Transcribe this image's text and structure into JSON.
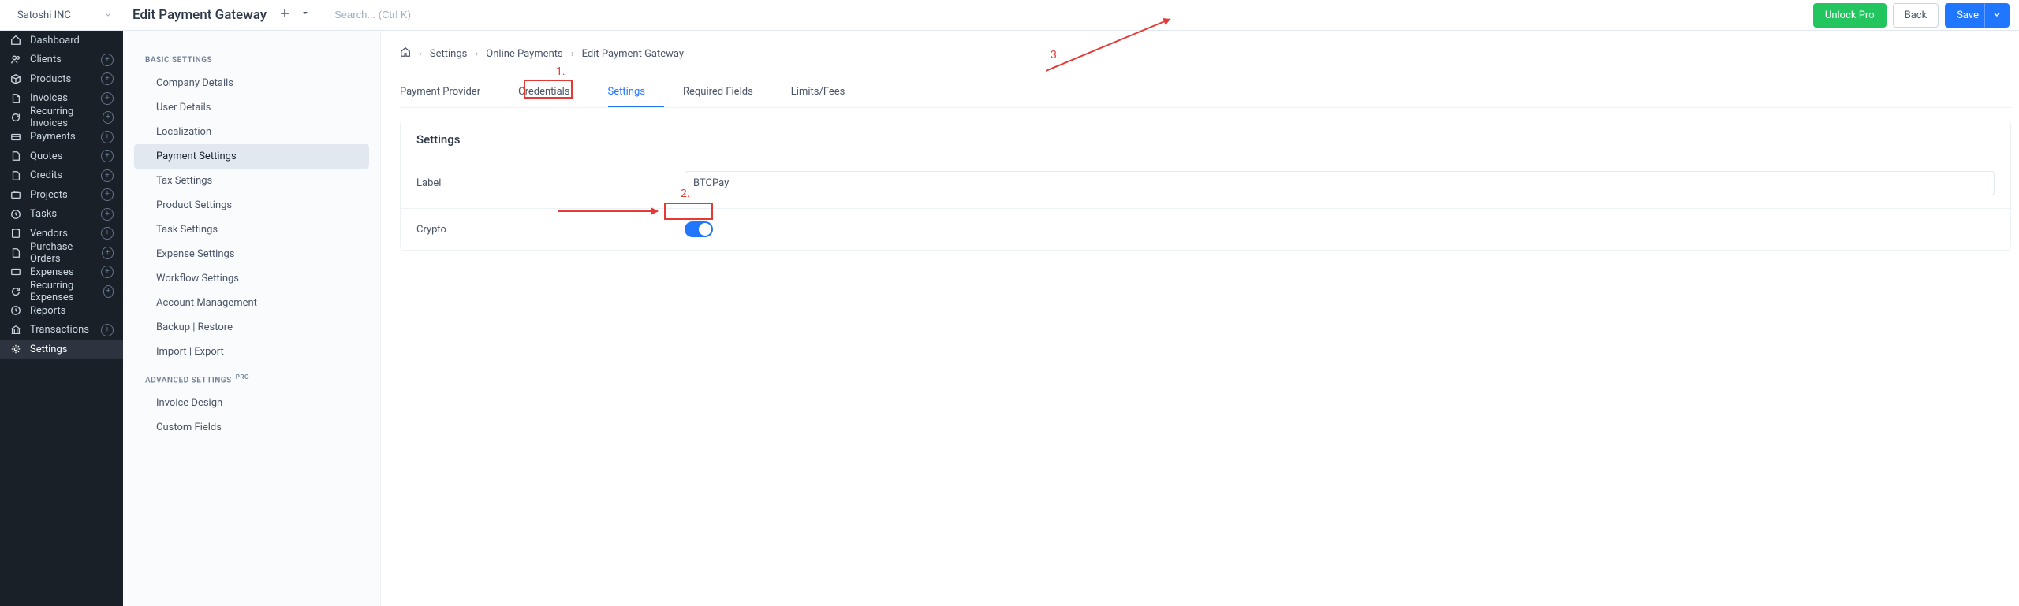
{
  "topbar": {
    "company_name": "Satoshi INC",
    "page_title": "Edit Payment Gateway",
    "search_placeholder": "Search... (Ctrl K)",
    "unlock_pro": "Unlock Pro",
    "back": "Back",
    "save": "Save"
  },
  "sidebar": {
    "items": [
      {
        "label": "Dashboard",
        "plus": false
      },
      {
        "label": "Clients",
        "plus": true
      },
      {
        "label": "Products",
        "plus": true
      },
      {
        "label": "Invoices",
        "plus": true
      },
      {
        "label": "Recurring Invoices",
        "plus": true
      },
      {
        "label": "Payments",
        "plus": true
      },
      {
        "label": "Quotes",
        "plus": true
      },
      {
        "label": "Credits",
        "plus": true
      },
      {
        "label": "Projects",
        "plus": true
      },
      {
        "label": "Tasks",
        "plus": true
      },
      {
        "label": "Vendors",
        "plus": true
      },
      {
        "label": "Purchase Orders",
        "plus": true
      },
      {
        "label": "Expenses",
        "plus": true
      },
      {
        "label": "Recurring Expenses",
        "plus": true
      },
      {
        "label": "Reports",
        "plus": false
      },
      {
        "label": "Transactions",
        "plus": true
      },
      {
        "label": "Settings",
        "plus": false
      }
    ]
  },
  "sub_sidebar": {
    "basic_header": "BASIC SETTINGS",
    "advanced_header": "ADVANCED SETTINGS",
    "pro_badge": "PRO",
    "basic": [
      "Company Details",
      "User Details",
      "Localization",
      "Payment Settings",
      "Tax Settings",
      "Product Settings",
      "Task Settings",
      "Expense Settings",
      "Workflow Settings",
      "Account Management",
      "Backup | Restore",
      "Import | Export"
    ],
    "advanced": [
      "Invoice Design",
      "Custom Fields"
    ]
  },
  "breadcrumb": {
    "c1": "Settings",
    "c2": "Online Payments",
    "c3": "Edit Payment Gateway"
  },
  "tabs": {
    "t0": "Payment Provider",
    "t1": "Credentials",
    "t2": "Settings",
    "t3": "Required Fields",
    "t4": "Limits/Fees"
  },
  "card": {
    "header": "Settings",
    "label_field": "Label",
    "label_value": "BTCPay",
    "crypto_field": "Crypto"
  },
  "annotations": {
    "n1": "1.",
    "n2": "2.",
    "n3": "3."
  }
}
